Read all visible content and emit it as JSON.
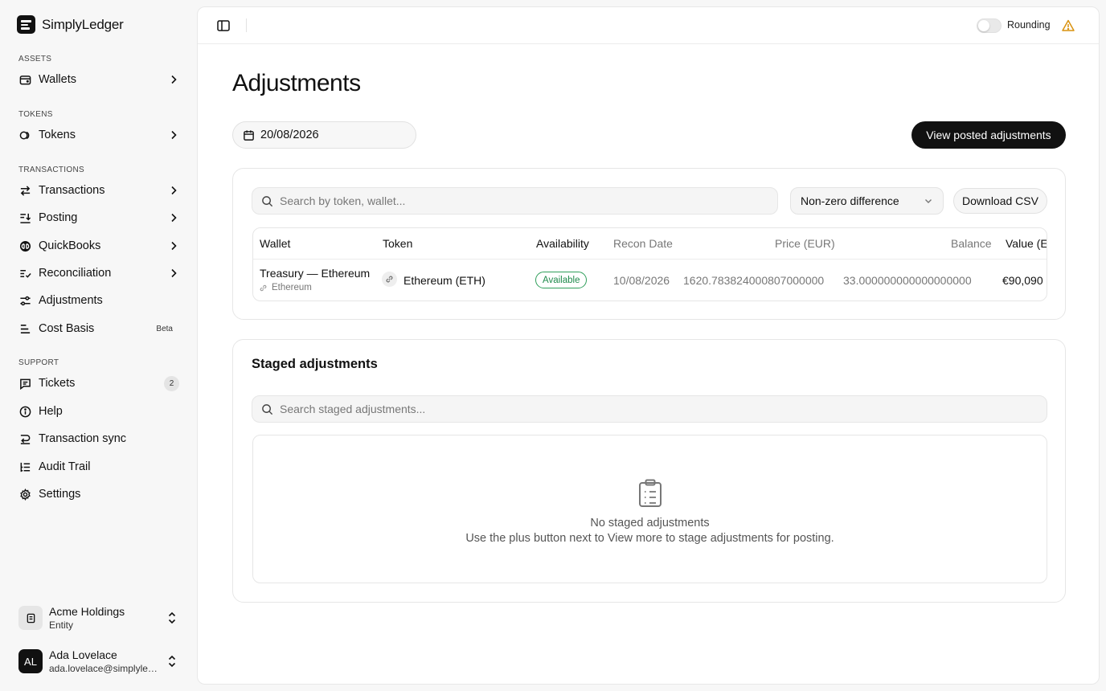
{
  "brand": {
    "name": "SimplyLedger"
  },
  "sidebar": {
    "sections": [
      "ASSETS",
      "TOKENS",
      "TRANSACTIONS",
      "SUPPORT"
    ],
    "items": [
      {
        "label": "Wallets"
      },
      {
        "label": "Tokens"
      },
      {
        "label": "Transactions"
      },
      {
        "label": "Posting"
      },
      {
        "label": "QuickBooks"
      },
      {
        "label": "Reconciliation"
      },
      {
        "label": "Adjustments"
      },
      {
        "label": "Cost Basis",
        "badge": "Beta"
      },
      {
        "label": "Tickets",
        "count": "2"
      },
      {
        "label": "Help"
      },
      {
        "label": "Transaction sync"
      },
      {
        "label": "Audit Trail"
      },
      {
        "label": "Settings"
      }
    ],
    "org": {
      "name": "Acme Holdings",
      "type": "Entity"
    },
    "user": {
      "initials": "AL",
      "name": "Ada Lovelace",
      "email": "ada.lovelace@simplyledger.com"
    }
  },
  "topbar": {
    "rounding_label": "Rounding",
    "rounding_on": false
  },
  "page": {
    "title": "Adjustments",
    "date": "20/08/2026",
    "view_posted_label": "View posted adjustments"
  },
  "balances": {
    "search_placeholder": "Search by token, wallet...",
    "filter_value": "Non-zero difference",
    "download_label": "Download CSV",
    "columns": [
      "Wallet",
      "Token",
      "Availability",
      "Recon Date",
      "Price (EUR)",
      "Balance",
      "Value (EUR)"
    ],
    "rows": [
      {
        "wallet": "Treasury — Ethereum",
        "network": "Ethereum",
        "token": "Ethereum (ETH)",
        "availability": "Available",
        "recon_date": "10/08/2026",
        "price": "1620.783824000807000000",
        "balance": "33.000000000000000000",
        "value": "€90,090"
      }
    ]
  },
  "staged": {
    "title": "Staged adjustments",
    "search_placeholder": "Search staged adjustments...",
    "empty_title": "No staged adjustments",
    "empty_desc": "Use the plus button next to View more to stage adjustments for posting."
  }
}
